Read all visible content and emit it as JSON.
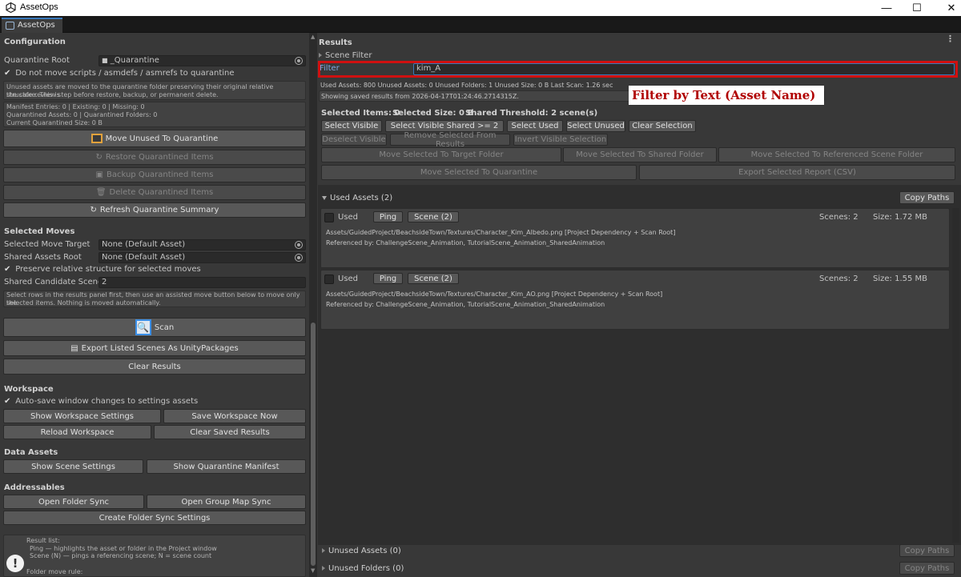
{
  "window": {
    "title": "AssetOps",
    "tab": "AssetOps"
  },
  "config": {
    "section_title": "Configuration",
    "quarantine_root_label": "Quarantine Root",
    "quarantine_root_value": "_Quarantine",
    "no_move_scripts_label": "Do not move scripts / asmdefs / asmrefs to quarantine",
    "help_text_1": "Unused assets are moved to the quarantine folder preserving their original relative structure. This is",
    "help_text_2": "the safe review step before restore, backup, or permanent delete.",
    "manifest_line_1": "Manifest Entries: 0  |  Existing: 0  |  Missing: 0",
    "manifest_line_2": "Quarantined Assets: 0  |  Quarantined Folders: 0",
    "manifest_line_3": "Current Quarantined Size: 0 B",
    "move_unused_btn": "Move Unused To Quarantine",
    "restore_btn": "Restore Quarantined Items",
    "backup_btn": "Backup Quarantined Items",
    "delete_btn": "Delete Quarantined Items",
    "refresh_btn": "Refresh Quarantine Summary"
  },
  "moves": {
    "section_title": "Selected Moves",
    "target_label": "Selected Move Target",
    "target_value": "None (Default Asset)",
    "shared_root_label": "Shared Assets Root",
    "shared_root_value": "None (Default Asset)",
    "preserve_label": "Preserve relative structure for selected moves",
    "shared_candidate_label": "Shared Candidate Scene C",
    "shared_candidate_value": "2",
    "help_1": "Select rows in the results panel first, then use an assisted move button below to move only the",
    "help_2": "selected items. Nothing is moved automatically.",
    "scan_btn": "Scan",
    "export_btn": "Export Listed Scenes As UnityPackages",
    "clear_btn": "Clear Results"
  },
  "workspace": {
    "section_title": "Workspace",
    "autosave_label": "Auto-save window changes to settings assets",
    "show_settings_btn": "Show Workspace Settings",
    "save_now_btn": "Save Workspace Now",
    "reload_btn": "Reload Workspace",
    "clear_saved_btn": "Clear Saved Results"
  },
  "data_assets": {
    "section_title": "Data Assets",
    "scene_settings_btn": "Show Scene Settings",
    "manifest_btn": "Show Quarantine Manifest"
  },
  "addressables": {
    "section_title": "Addressables",
    "folder_sync_btn": "Open Folder Sync",
    "group_map_btn": "Open Group Map Sync",
    "create_btn": "Create Folder Sync Settings"
  },
  "legend": {
    "line_1": "Result list:",
    "line_2": "Ping — highlights the asset or folder in the Project window",
    "line_3": "Scene (N) — pings a referencing scene; N = scene count",
    "line_4": "Folder move rule:"
  },
  "results": {
    "section_title": "Results",
    "scene_filter_label": "Scene Filter",
    "filter_label": "Filter",
    "filter_value": "kim_A",
    "stats": "Used Assets: 800    Unused Assets: 0    Unused Folders: 1    Unused Size: 0 B    Last Scan: 1.26 sec",
    "saved_info": "Showing saved results from 2026-04-17T01:24:46.2714315Z.",
    "callout": "Filter by Text (Asset Name)",
    "selected_items": "Selected Items: 0",
    "selected_size": "Selected Size: 0 B",
    "shared_threshold": "Shared Threshold: 2 scene(s)",
    "btn_select_visible": "Select Visible",
    "btn_select_shared": "Select Visible Shared >= 2",
    "btn_select_used": "Select Used",
    "btn_select_unused": "Select Unused",
    "btn_clear_selection": "Clear Selection",
    "btn_deselect_visible": "Deselect Visible",
    "btn_remove_selected": "Remove Selected From Results",
    "btn_invert_visible": "Invert Visible Selection",
    "btn_move_target": "Move Selected To Target Folder",
    "btn_move_shared": "Move Selected To Shared Folder",
    "btn_move_referenced": "Move Selected To Referenced Scene Folder",
    "btn_move_quarantine": "Move Selected To Quarantine",
    "btn_export_report": "Export Selected Report (CSV)",
    "used_header": "Used Assets (2)",
    "copy_paths": "Copy Paths",
    "unused_header": "Unused Assets (0)",
    "unused_folders_header": "Unused Folders (0)",
    "items": [
      {
        "status": "Used",
        "ping": "Ping",
        "scene": "Scene (2)",
        "scenes": "Scenes: 2",
        "size": "Size: 1.72 MB",
        "path": "Assets/GuidedProject/BeachsideTown/Textures/Character_Kim_Albedo.png    [Project Dependency + Scan Root]",
        "refs": "Referenced by: ChallengeScene_Animation, TutorialScene_Animation_SharedAnimation"
      },
      {
        "status": "Used",
        "ping": "Ping",
        "scene": "Scene (2)",
        "scenes": "Scenes: 2",
        "size": "Size: 1.55 MB",
        "path": "Assets/GuidedProject/BeachsideTown/Textures/Character_Kim_AO.png    [Project Dependency + Scan Root]",
        "refs": "Referenced by: ChallengeScene_Animation, TutorialScene_Animation_SharedAnimation"
      }
    ]
  }
}
